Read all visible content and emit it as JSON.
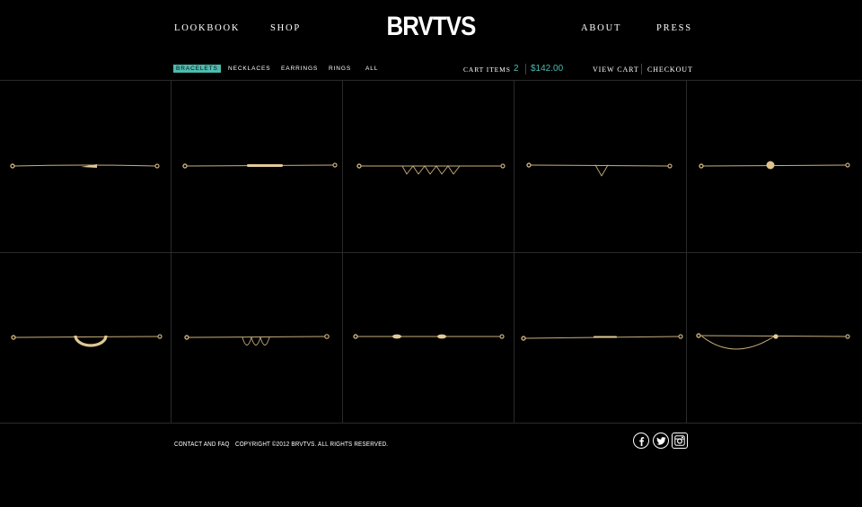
{
  "nav": {
    "lookbook": "LOOKBOOK",
    "shop": "SHOP",
    "brand": "BRVTVS",
    "about": "ABOUT",
    "press": "PRESS"
  },
  "categories": [
    {
      "label": "BRACELETS",
      "active": true
    },
    {
      "label": "NECKLACES",
      "active": false
    },
    {
      "label": "EARRINGS",
      "active": false
    },
    {
      "label": "RINGS",
      "active": false
    },
    {
      "label": "ALL",
      "active": false
    }
  ],
  "cart": {
    "label": "CART ITEMS",
    "count": "2",
    "total": "$142.00",
    "view_cart": "VIEW CART",
    "checkout": "CHECKOUT"
  },
  "products": [
    {
      "charm": "bar-wedge"
    },
    {
      "charm": "long-bar"
    },
    {
      "charm": "triple-zigzag"
    },
    {
      "charm": "single-v"
    },
    {
      "charm": "ball"
    },
    {
      "charm": "half-circle"
    },
    {
      "charm": "wave"
    },
    {
      "charm": "double-bead"
    },
    {
      "charm": "thin-bar"
    },
    {
      "charm": "draped-chain"
    }
  ],
  "footer": {
    "contact": "CONTACT AND FAQ",
    "copyright": "COPYRIGHT ©2012 BRVTVS. ALL RIGHTS RESERVED."
  },
  "social": [
    "facebook-icon",
    "twitter-icon",
    "instagram-icon"
  ],
  "colors": {
    "background": "#000000",
    "accent": "#4cbcb0",
    "gold": "#c9ae7c",
    "grid_line": "#2a2a2a"
  }
}
